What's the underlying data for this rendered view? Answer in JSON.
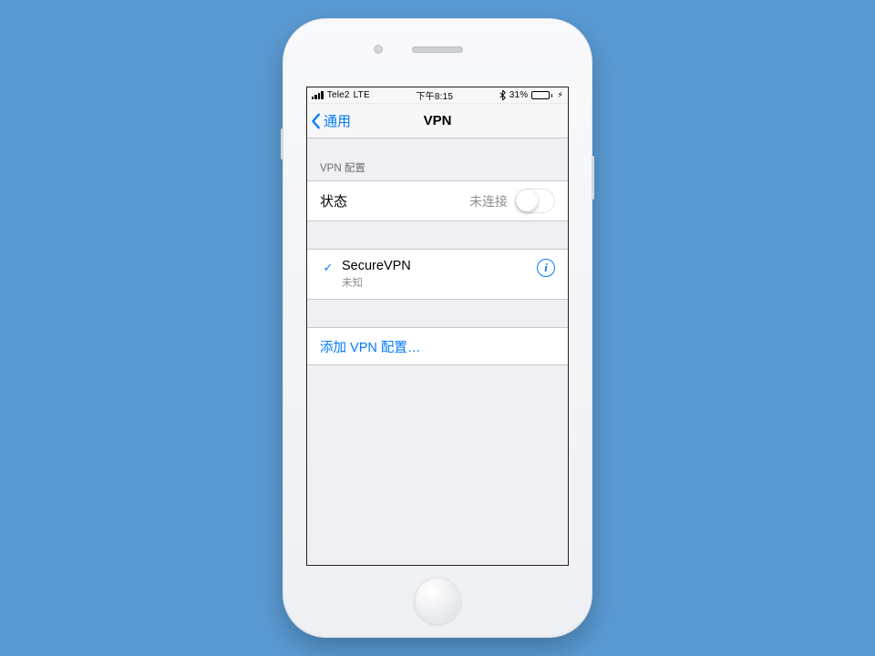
{
  "status_bar": {
    "carrier": "Tele2",
    "network": "LTE",
    "time": "下午8:15",
    "bluetooth_icon": "bluetooth",
    "battery_pct_label": "31%",
    "battery_pct": 31,
    "charging": true
  },
  "nav": {
    "back_label": "通用",
    "title": "VPN"
  },
  "sections": {
    "config_header": "VPN 配置",
    "status_row": {
      "label": "状态",
      "value": "未连接",
      "toggle_on": false
    },
    "vpn_items": [
      {
        "selected": true,
        "name": "SecureVPN",
        "subtitle": "未知"
      }
    ],
    "add_config_label": "添加 VPN 配置…"
  },
  "info_glyph": "i",
  "check_glyph": "✓"
}
